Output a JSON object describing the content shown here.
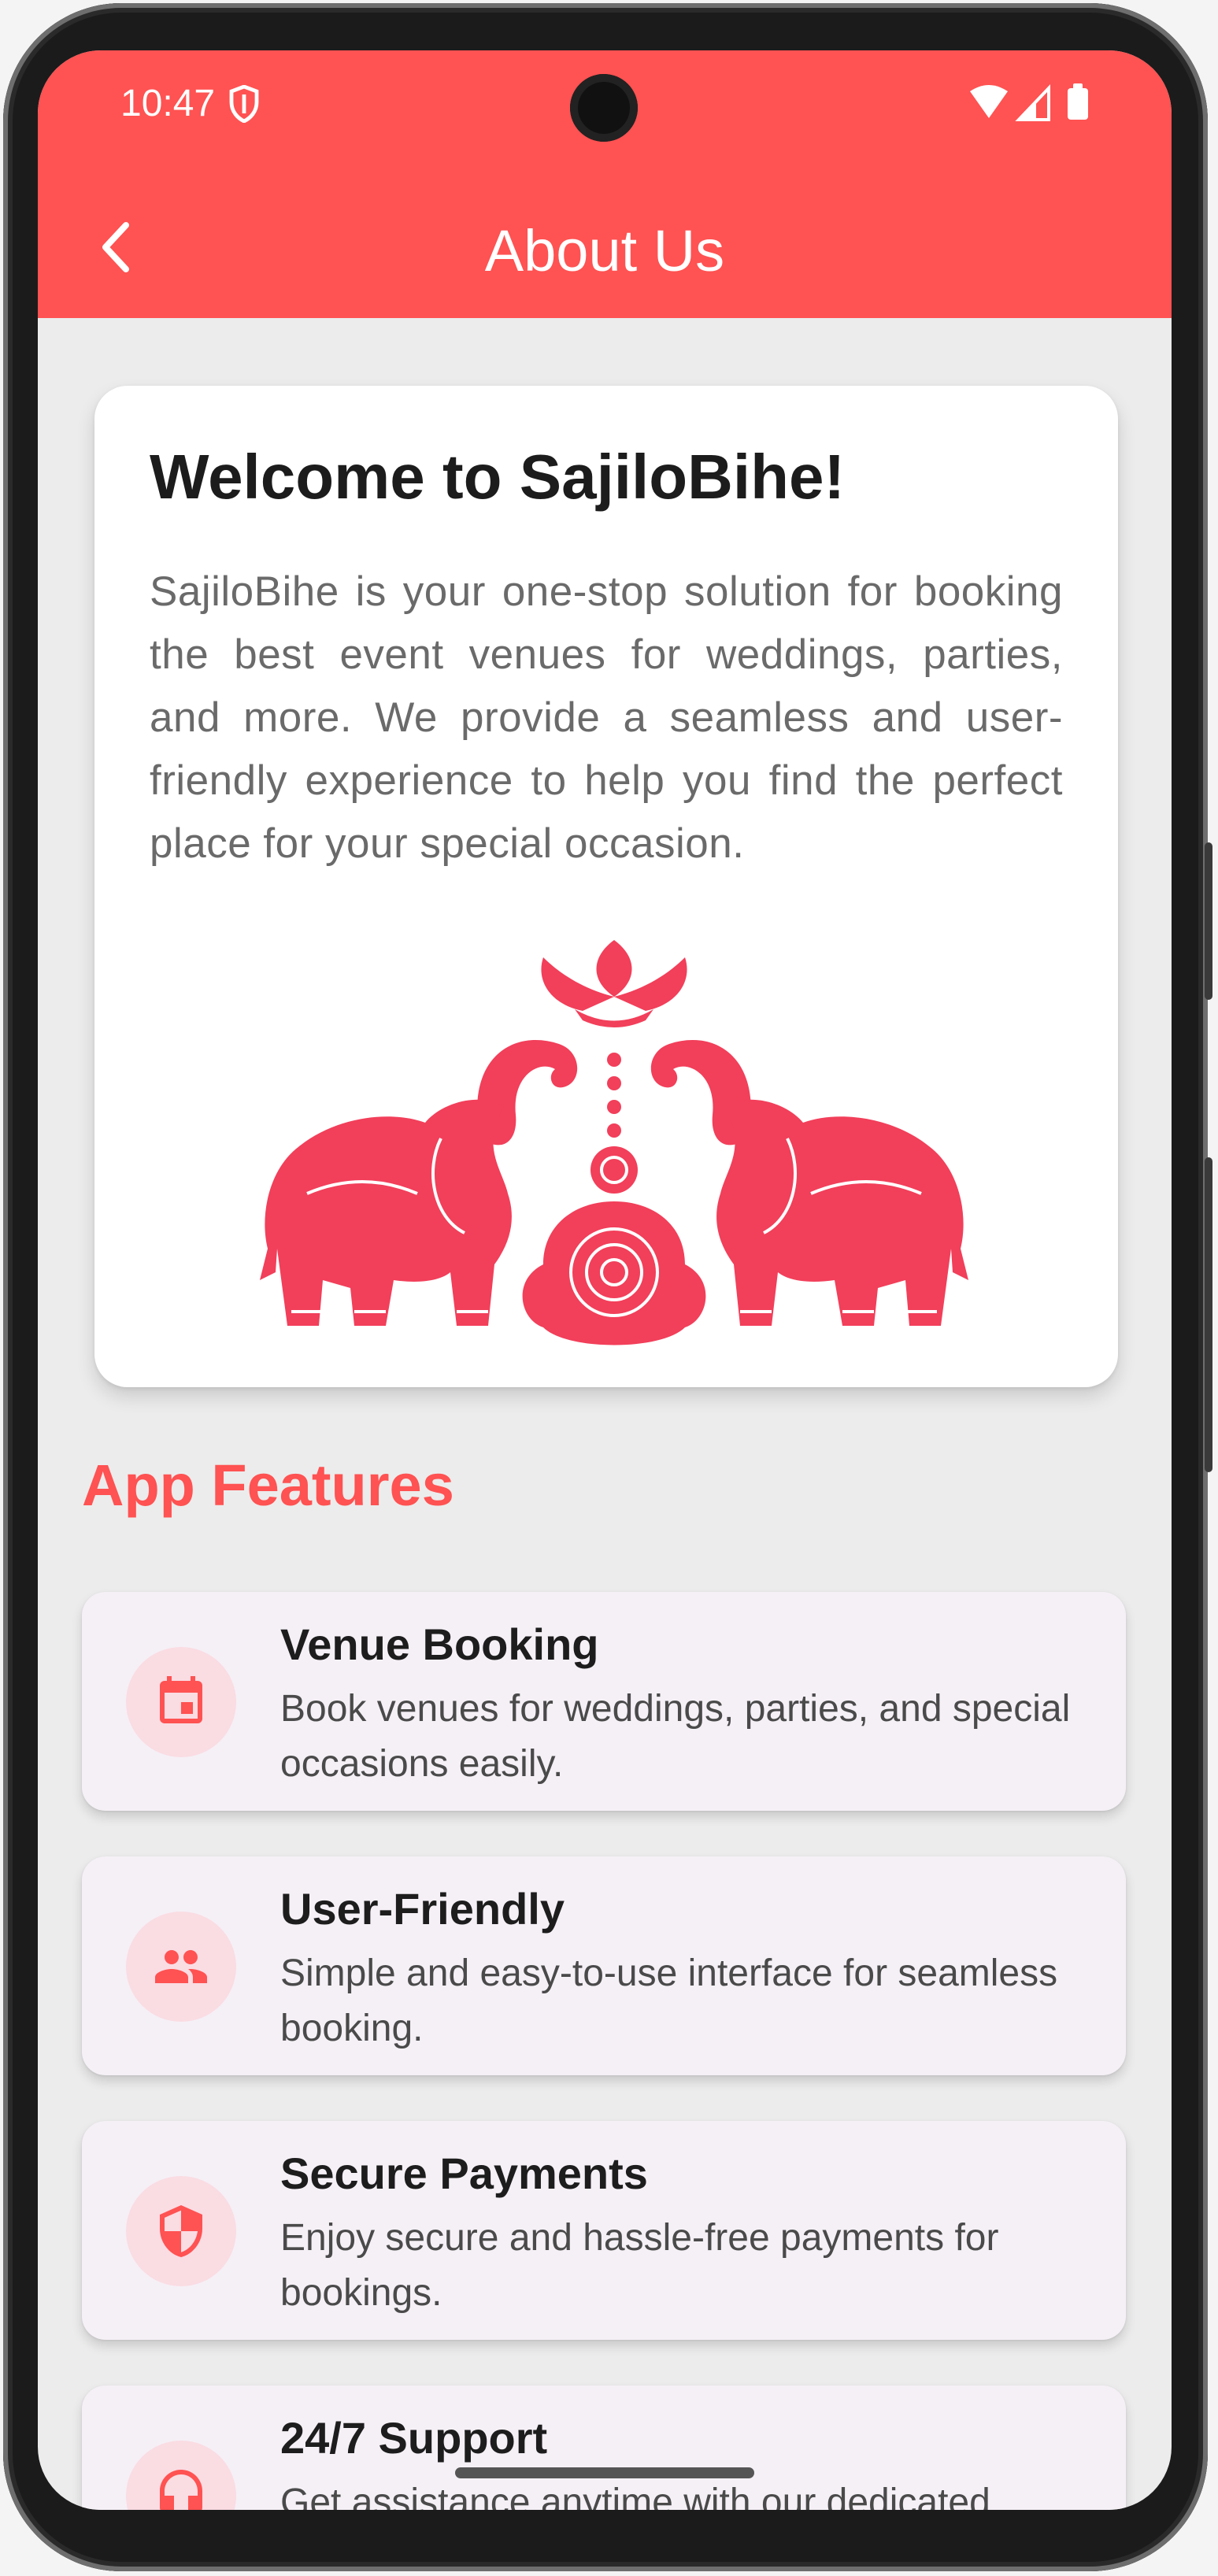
{
  "status_bar": {
    "time": "10:47"
  },
  "header": {
    "title": "About Us"
  },
  "welcome": {
    "heading": "Welcome to SajiloBihe!",
    "body": "SajiloBihe is your one-stop solution for booking the best event venues for weddings, parties, and more. We provide a seamless and user-friendly experience to help you find the perfect place for your special occasion."
  },
  "features": {
    "title": "App Features",
    "items": [
      {
        "icon": "calendar-icon",
        "title": "Venue Booking",
        "description": "Book venues for weddings, parties, and special occasions easily."
      },
      {
        "icon": "people-icon",
        "title": "User-Friendly",
        "description": "Simple and easy-to-use interface for seamless booking."
      },
      {
        "icon": "shield-icon",
        "title": "Secure Payments",
        "description": "Enjoy secure and hassle-free payments for bookings."
      },
      {
        "icon": "headset-icon",
        "title": "24/7 Support",
        "description": "Get assistance anytime with our dedicated"
      }
    ]
  },
  "colors": {
    "primary": "#ff5252",
    "illustration": "#f23f5a",
    "feature_card": "#f5f0f6",
    "icon_bg": "#fadce3"
  }
}
